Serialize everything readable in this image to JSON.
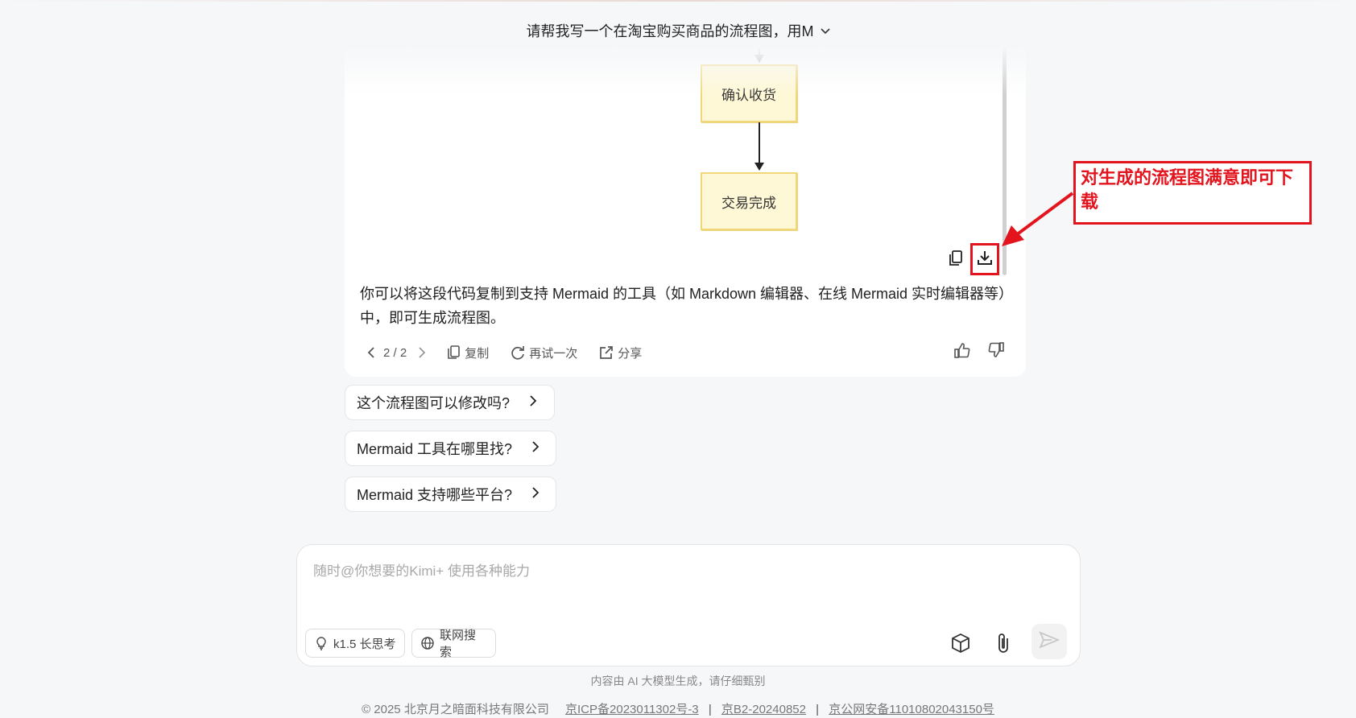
{
  "header": {
    "conversation_title": "请帮我写一个在淘宝购买商品的流程图，用M"
  },
  "diagram": {
    "nodes": [
      "确认收货",
      "交易完成"
    ]
  },
  "annotation": {
    "text": "对生成的流程图满意即可下载"
  },
  "answer": {
    "text": "你可以将这段代码复制到支持 Mermaid 的工具（如 Markdown 编辑器、在线 Mermaid 实时编辑器等）中，即可生成流程图。"
  },
  "actions": {
    "pager": "2 / 2",
    "copy": "复制",
    "retry": "再试一次",
    "share": "分享"
  },
  "suggestions": [
    "这个流程图可以修改吗?",
    "Mermaid 工具在哪里找?",
    "Mermaid 支持哪些平台?"
  ],
  "composer": {
    "placeholder": "随时@你想要的Kimi+ 使用各种能力",
    "thinking_label": "k1.5 长思考",
    "search_label": "联网搜索"
  },
  "disclaimer": "内容由 AI 大模型生成，请仔细甄别",
  "footer": {
    "copyright": "© 2025 北京月之暗面科技有限公司",
    "icp": "京ICP备2023011302号-3",
    "b2": "京B2-20240852",
    "police": "京公网安备11010802043150号"
  }
}
